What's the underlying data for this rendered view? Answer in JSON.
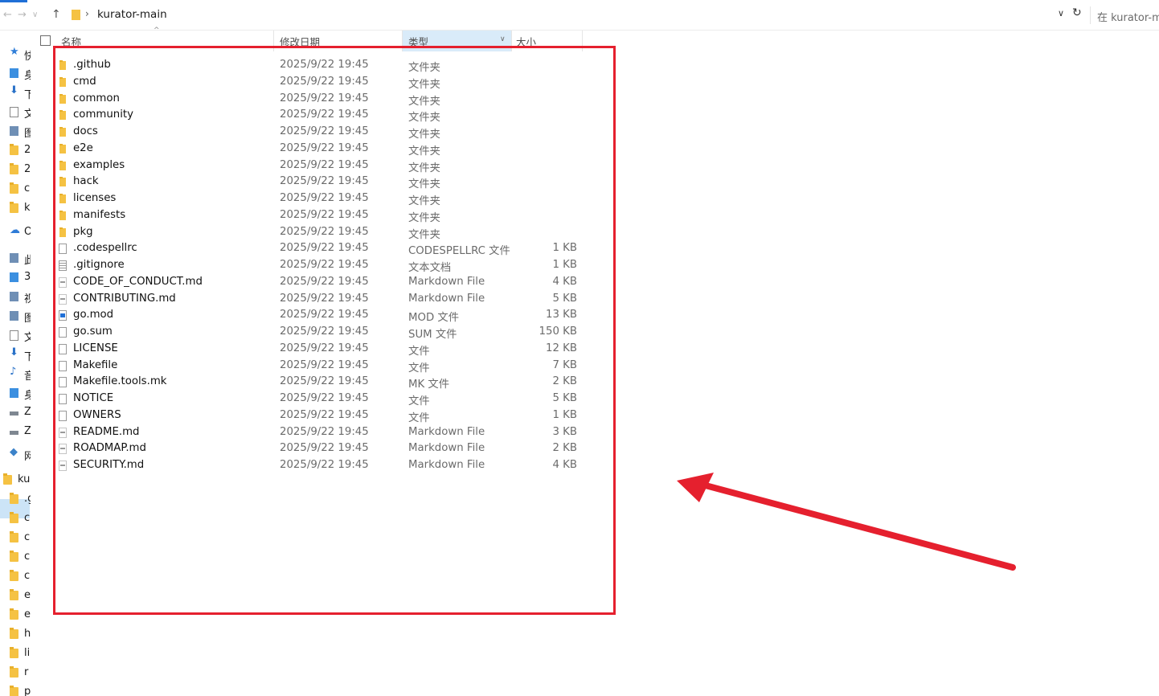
{
  "address_bar": {
    "path_label": "kurator-main",
    "search_placeholder": "在 kurator-m"
  },
  "nav_pane": {
    "items": [
      {
        "icon": "star-icon",
        "label": "快"
      },
      {
        "icon": "desktop-icon",
        "label": "身"
      },
      {
        "icon": "download-icon",
        "label": "下"
      },
      {
        "icon": "document-icon",
        "label": "文"
      },
      {
        "icon": "picture-icon",
        "label": "图"
      },
      {
        "icon": "folder-icon",
        "label": "2"
      },
      {
        "icon": "folder-icon",
        "label": "2"
      },
      {
        "icon": "folder-icon",
        "label": "c"
      },
      {
        "icon": "folder-icon",
        "label": "k"
      },
      {
        "icon": "onedrive-icon",
        "label": "Or"
      },
      {
        "icon": "this-pc-icon",
        "label": "此"
      },
      {
        "icon": "3d-objects-icon",
        "label": "3"
      },
      {
        "icon": "video-icon",
        "label": "视"
      },
      {
        "icon": "picture-icon",
        "label": "图"
      },
      {
        "icon": "document-icon",
        "label": "文"
      },
      {
        "icon": "download-icon",
        "label": "下"
      },
      {
        "icon": "music-icon",
        "label": "音"
      },
      {
        "icon": "desktop-icon",
        "label": "身"
      },
      {
        "icon": "drive-icon",
        "label": "Z"
      },
      {
        "icon": "drive-icon",
        "label": "Z"
      },
      {
        "icon": "network-icon",
        "label": "网"
      },
      {
        "icon": "folder-icon",
        "label": "ku"
      },
      {
        "icon": "folder-icon",
        "label": ".g"
      },
      {
        "icon": "folder-icon",
        "label": "c"
      },
      {
        "icon": "folder-icon",
        "label": "c"
      },
      {
        "icon": "folder-icon",
        "label": "c"
      },
      {
        "icon": "folder-icon",
        "label": "c"
      },
      {
        "icon": "folder-icon",
        "label": "e"
      },
      {
        "icon": "folder-icon",
        "label": "e"
      },
      {
        "icon": "folder-icon",
        "label": "h"
      },
      {
        "icon": "folder-icon",
        "label": "li"
      },
      {
        "icon": "folder-icon",
        "label": "r"
      },
      {
        "icon": "folder-icon",
        "label": "p"
      }
    ]
  },
  "columns": {
    "name": "名称",
    "date": "修改日期",
    "type": "类型",
    "size": "大小"
  },
  "files": [
    {
      "icon": "folder-icon",
      "name": ".github",
      "date": "2025/9/22 19:45",
      "type": "文件夹",
      "size": ""
    },
    {
      "icon": "folder-icon",
      "name": "cmd",
      "date": "2025/9/22 19:45",
      "type": "文件夹",
      "size": ""
    },
    {
      "icon": "folder-icon",
      "name": "common",
      "date": "2025/9/22 19:45",
      "type": "文件夹",
      "size": ""
    },
    {
      "icon": "folder-icon",
      "name": "community",
      "date": "2025/9/22 19:45",
      "type": "文件夹",
      "size": ""
    },
    {
      "icon": "folder-icon",
      "name": "docs",
      "date": "2025/9/22 19:45",
      "type": "文件夹",
      "size": ""
    },
    {
      "icon": "folder-icon",
      "name": "e2e",
      "date": "2025/9/22 19:45",
      "type": "文件夹",
      "size": ""
    },
    {
      "icon": "folder-icon",
      "name": "examples",
      "date": "2025/9/22 19:45",
      "type": "文件夹",
      "size": ""
    },
    {
      "icon": "folder-icon",
      "name": "hack",
      "date": "2025/9/22 19:45",
      "type": "文件夹",
      "size": ""
    },
    {
      "icon": "folder-icon",
      "name": "licenses",
      "date": "2025/9/22 19:45",
      "type": "文件夹",
      "size": ""
    },
    {
      "icon": "folder-icon",
      "name": "manifests",
      "date": "2025/9/22 19:45",
      "type": "文件夹",
      "size": ""
    },
    {
      "icon": "folder-icon",
      "name": "pkg",
      "date": "2025/9/22 19:45",
      "type": "文件夹",
      "size": ""
    },
    {
      "icon": "file-icon",
      "name": ".codespellrc",
      "date": "2025/9/22 19:45",
      "type": "CODESPELLRC 文件",
      "size": "1 KB"
    },
    {
      "icon": "text-file-icon",
      "name": ".gitignore",
      "date": "2025/9/22 19:45",
      "type": "文本文档",
      "size": "1 KB"
    },
    {
      "icon": "markdown-file-icon",
      "name": "CODE_OF_CONDUCT.md",
      "date": "2025/9/22 19:45",
      "type": "Markdown File",
      "size": "4 KB"
    },
    {
      "icon": "markdown-file-icon",
      "name": "CONTRIBUTING.md",
      "date": "2025/9/22 19:45",
      "type": "Markdown File",
      "size": "5 KB"
    },
    {
      "icon": "mod-file-icon",
      "name": "go.mod",
      "date": "2025/9/22 19:45",
      "type": "MOD 文件",
      "size": "13 KB"
    },
    {
      "icon": "file-icon",
      "name": "go.sum",
      "date": "2025/9/22 19:45",
      "type": "SUM 文件",
      "size": "150 KB"
    },
    {
      "icon": "file-icon",
      "name": "LICENSE",
      "date": "2025/9/22 19:45",
      "type": "文件",
      "size": "12 KB"
    },
    {
      "icon": "file-icon",
      "name": "Makefile",
      "date": "2025/9/22 19:45",
      "type": "文件",
      "size": "7 KB"
    },
    {
      "icon": "file-icon",
      "name": "Makefile.tools.mk",
      "date": "2025/9/22 19:45",
      "type": "MK 文件",
      "size": "2 KB"
    },
    {
      "icon": "file-icon",
      "name": "NOTICE",
      "date": "2025/9/22 19:45",
      "type": "文件",
      "size": "5 KB"
    },
    {
      "icon": "file-icon",
      "name": "OWNERS",
      "date": "2025/9/22 19:45",
      "type": "文件",
      "size": "1 KB"
    },
    {
      "icon": "markdown-file-icon",
      "name": "README.md",
      "date": "2025/9/22 19:45",
      "type": "Markdown File",
      "size": "3 KB"
    },
    {
      "icon": "markdown-file-icon",
      "name": "ROADMAP.md",
      "date": "2025/9/22 19:45",
      "type": "Markdown File",
      "size": "2 KB"
    },
    {
      "icon": "markdown-file-icon",
      "name": "SECURITY.md",
      "date": "2025/9/22 19:45",
      "type": "Markdown File",
      "size": "4 KB"
    }
  ],
  "annotation": {
    "color": "#e5202e"
  }
}
